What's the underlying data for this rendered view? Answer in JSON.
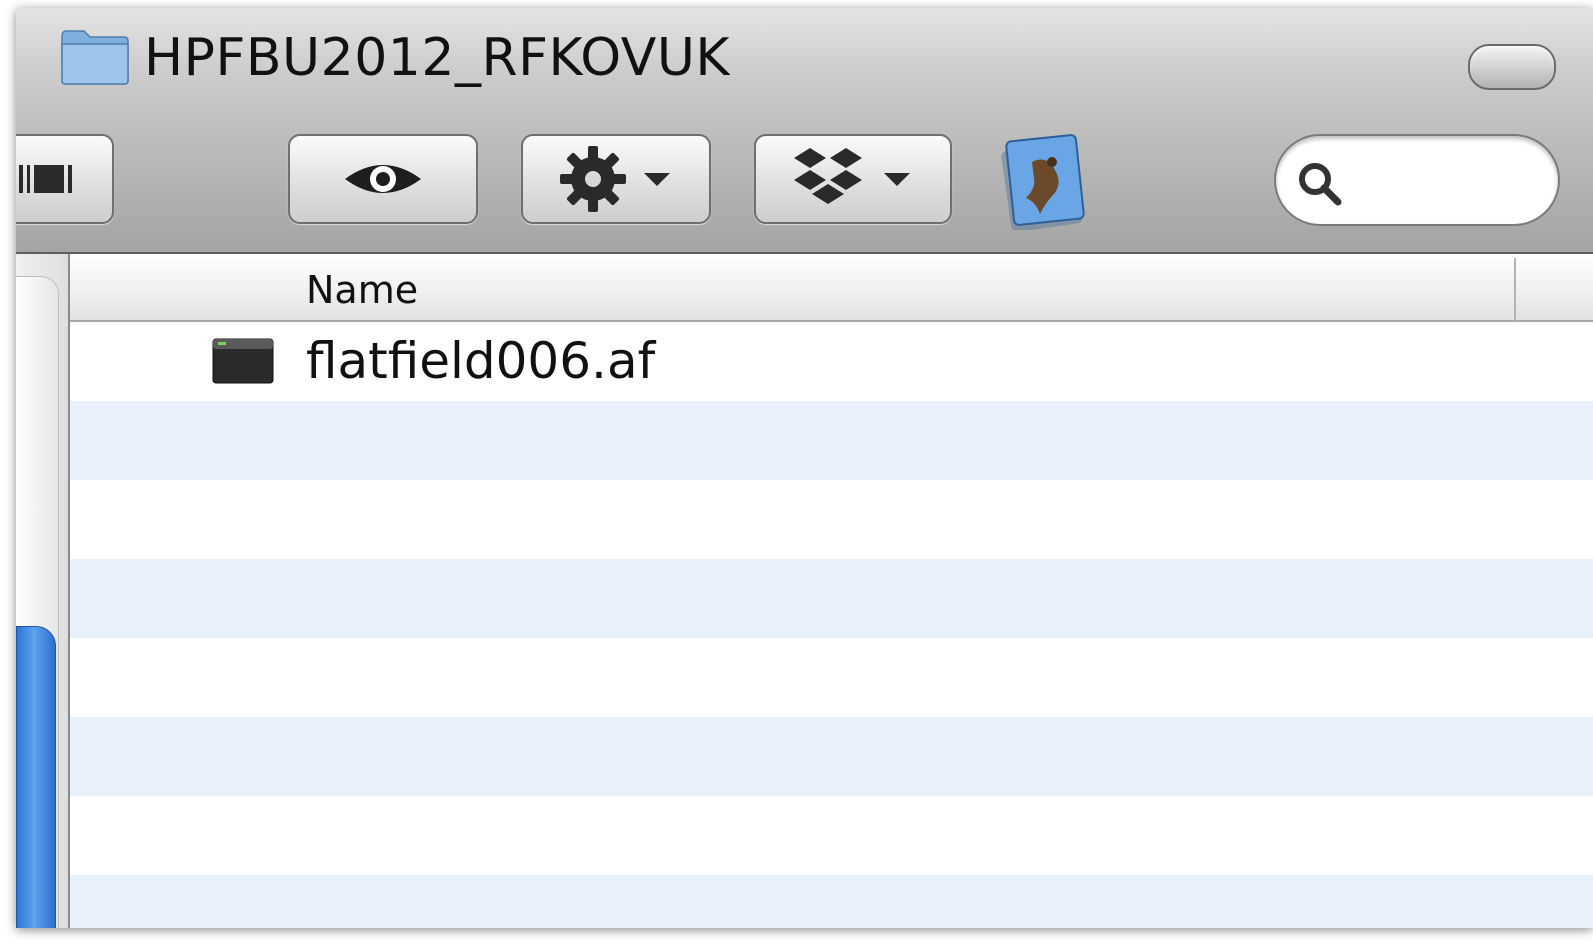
{
  "window": {
    "title": "HPFBU2012_RFKOVUK"
  },
  "toolbar": {
    "buttons": [
      {
        "name": "view-mode",
        "icon": "column-view-icon"
      },
      {
        "name": "quick-look",
        "icon": "eye-icon"
      },
      {
        "name": "action",
        "icon": "gear-icon"
      },
      {
        "name": "dropbox",
        "icon": "dropbox-icon"
      }
    ],
    "app_icon": "preview-hawk-icon",
    "search": {
      "placeholder": "",
      "value": ""
    }
  },
  "list": {
    "columns": [
      "Name"
    ],
    "files": [
      {
        "name": "flatfield006.af",
        "icon": "executable-file-icon"
      }
    ]
  },
  "colors": {
    "row_stripe": "#e8f0fb",
    "scroll_thumb": "#3c86df"
  }
}
